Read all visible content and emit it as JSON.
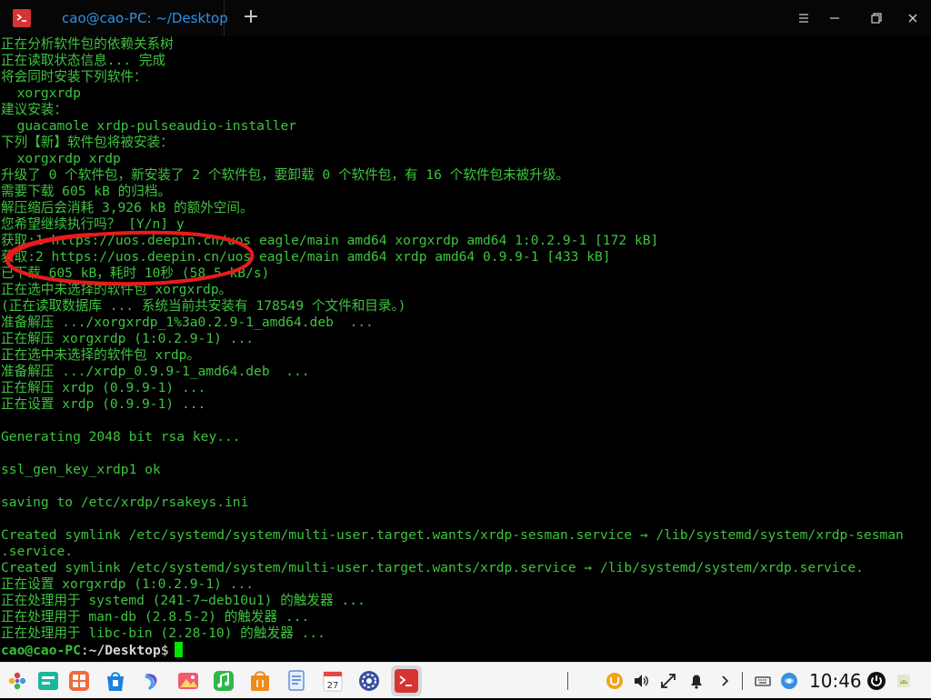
{
  "window": {
    "tab_title": "cao@cao-PC: ~/Desktop",
    "new_tab_glyph": "+"
  },
  "terminal": {
    "lines": [
      "正在分析软件包的依赖关系树",
      "正在读取状态信息... 完成",
      "将会同时安装下列软件：",
      "  xorgxrdp",
      "建议安装：",
      "  guacamole xrdp-pulseaudio-installer",
      "下列【新】软件包将被安装：",
      "  xorgxrdp xrdp",
      "升级了 0 个软件包，新安装了 2 个软件包，要卸载 0 个软件包，有 16 个软件包未被升级。",
      "需要下载 605 kB 的归档。",
      "解压缩后会消耗 3,926 kB 的额外空间。",
      "您希望继续执行吗？ [Y/n] y",
      "获取:1 https://uos.deepin.cn/uos eagle/main amd64 xorgxrdp amd64 1:0.2.9-1 [172 kB]",
      "获取:2 https://uos.deepin.cn/uos eagle/main amd64 xrdp amd64 0.9.9-1 [433 kB]",
      "已下载 605 kB，耗时 10秒 (58.5 kB/s)",
      "正在选中未选择的软件包 xorgxrdp。",
      "(正在读取数据库 ... 系统当前共安装有 178549 个文件和目录。)",
      "准备解压 .../xorgxrdp_1%3a0.2.9-1_amd64.deb  ...",
      "正在解压 xorgxrdp (1:0.2.9-1) ...",
      "正在选中未选择的软件包 xrdp。",
      "准备解压 .../xrdp_0.9.9-1_amd64.deb  ...",
      "正在解压 xrdp (0.9.9-1) ...",
      "正在设置 xrdp (0.9.9-1) ...",
      "",
      "Generating 2048 bit rsa key...",
      "",
      "ssl_gen_key_xrdp1 ok",
      "",
      "saving to /etc/xrdp/rsakeys.ini",
      "",
      "Created symlink /etc/systemd/system/multi-user.target.wants/xrdp-sesman.service → /lib/systemd/system/xrdp-sesman",
      ".service.",
      "Created symlink /etc/systemd/system/multi-user.target.wants/xrdp.service → /lib/systemd/system/xrdp.service.",
      "正在设置 xorgxrdp (1:0.2.9-1) ...",
      "正在处理用于 systemd (241-7~deb10u1) 的触发器 ...",
      "正在处理用于 man-db (2.8.5-2) 的触发器 ...",
      "正在处理用于 libc-bin (2.28-10) 的触发器 ..."
    ],
    "prompt": {
      "user_host": "cao@cao-PC",
      "separator": ":",
      "cwd": "~/Desktop",
      "symbol": "$"
    },
    "annotation_color": "#e81b1b"
  },
  "dock": {
    "calendar_day": "27",
    "clock": "10:46"
  },
  "colors": {
    "terminal_text": "#3ec43e",
    "tab_title": "#2d93e8",
    "dock_bg": "#f5f5f5"
  }
}
